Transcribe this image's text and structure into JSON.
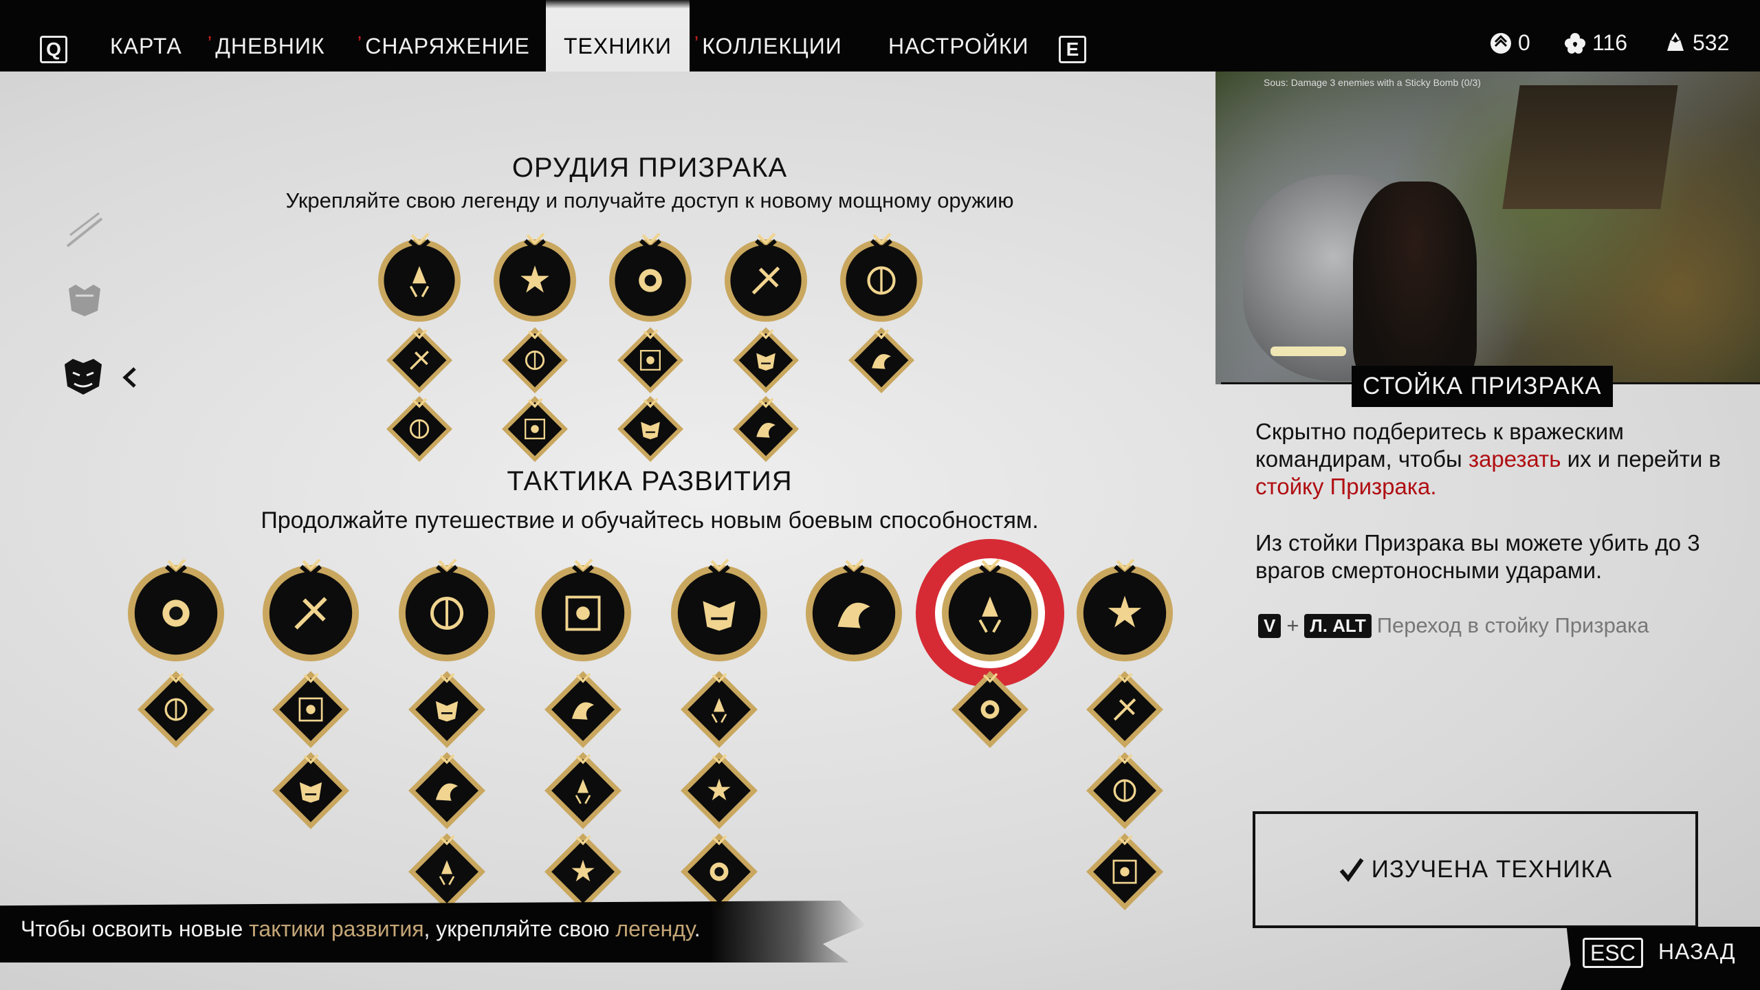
{
  "nav": {
    "left_key": "Q",
    "right_key": "E",
    "tabs": [
      {
        "label": "КАРТА",
        "marked": false,
        "active": false
      },
      {
        "label": "ДНЕВНИК",
        "marked": true,
        "active": false
      },
      {
        "label": "СНАРЯЖЕНИЕ",
        "marked": true,
        "active": false
      },
      {
        "label": "ТЕХНИКИ",
        "marked": false,
        "active": true
      },
      {
        "label": "КОЛЛЕКЦИИ",
        "marked": true,
        "active": false
      },
      {
        "label": "НАСТРОЙКИ",
        "marked": false,
        "active": false
      }
    ],
    "new_mark": "ʼ",
    "currencies": [
      {
        "icon": "skill-point-icon",
        "value": "0"
      },
      {
        "icon": "flower-icon",
        "value": "116"
      },
      {
        "icon": "supplies-icon",
        "value": "532"
      }
    ]
  },
  "rail": {
    "items": [
      "blade-category-icon",
      "armor-category-icon",
      "ghost-mask-category-icon"
    ],
    "selected_index": 2
  },
  "sections": {
    "ghost_tools": {
      "title": "ОРУДИЯ ПРИЗРАКА",
      "subtitle": "Укрепляйте свою легенду и получайте доступ к новому мощному оружию",
      "nodes": [
        "kunai-icon",
        "sticky-bomb-icon",
        "smoke-bomb-icon",
        "black-powder-bomb-icon",
        "wind-chime-icon"
      ],
      "upgrades": [
        [
          "kunai-upgrade-icon",
          "kunai-volley-icon"
        ],
        [
          "sticky-bomb-upgrade-icon",
          "sticky-bomb-blast-icon"
        ],
        [
          "smoke-bomb-upgrade-icon",
          "smoke-bomb-cloud-icon"
        ],
        [
          "powder-bomb-upgrade-icon",
          "powder-bomb-ring-icon"
        ],
        [
          "wind-chime-upgrade-icon"
        ]
      ]
    },
    "tactics": {
      "title": "ТАКТИКА РАЗВИТИЯ",
      "subtitle": "Продолжайте путешествие и обучайтесь новым боевым способностям.",
      "nodes": [
        "resolve-heal-icon",
        "ghost-weapon-strike-icon",
        "bow-icon",
        "assassination-icon",
        "listen-ear-icon",
        "shadow-hiding-icon",
        "ghost-stance-mask-icon",
        "horse-icon"
      ],
      "selected_index": 6,
      "upgrades": [
        [
          "heal-upgrade-icon"
        ],
        [
          "leap-icon",
          "dodge-icon"
        ],
        [
          "target-icon",
          "cycle-icon",
          "cycle-plus-icon"
        ],
        [
          "chain-assassination-icon",
          "double-skull-icon",
          "triple-skull-icon"
        ],
        [
          "sonar-icon",
          "dash-icon",
          "incognito-icon"
        ],
        [],
        [
          "ghost-stance-upgrade-icon"
        ],
        [
          "horse-upgrade-icon",
          "horse-charge-icon",
          "horse-mount-icon"
        ]
      ]
    }
  },
  "detail": {
    "preview_hud": "Sous: Damage 3 enemies with a Sticky Bomb (0/3)",
    "title": "СТОЙКА ПРИЗРАКА",
    "desc1_a": "Скрытно подберитесь к вражеским командирам, чтобы ",
    "desc1_b": "зарезать",
    "desc1_c": " их и перейти в ",
    "desc1_d": "стойку Призрака.",
    "desc2": "Из стойки Призрака вы можете убить до 3 врагов смертоносными ударами.",
    "key1": "V",
    "plus": "+",
    "key2": "Л. ALT",
    "key_action": "Переход в стойку Призрака",
    "learned_label": "ИЗУЧЕНА ТЕХНИКА"
  },
  "footer": {
    "hint_a": "Чтобы освоить новые ",
    "hint_b": "тактики развития",
    "hint_c": ", укрепляйте свою ",
    "hint_d": "легенду",
    "hint_e": ".",
    "back_key": "ESC",
    "back_label": "НАЗАД"
  },
  "colors": {
    "gold": "#c9a75f",
    "gold_light": "#f0d48f",
    "highlight_red": "#d5212b",
    "text_red": "#b00e12",
    "legend_gold": "#c4a676"
  }
}
